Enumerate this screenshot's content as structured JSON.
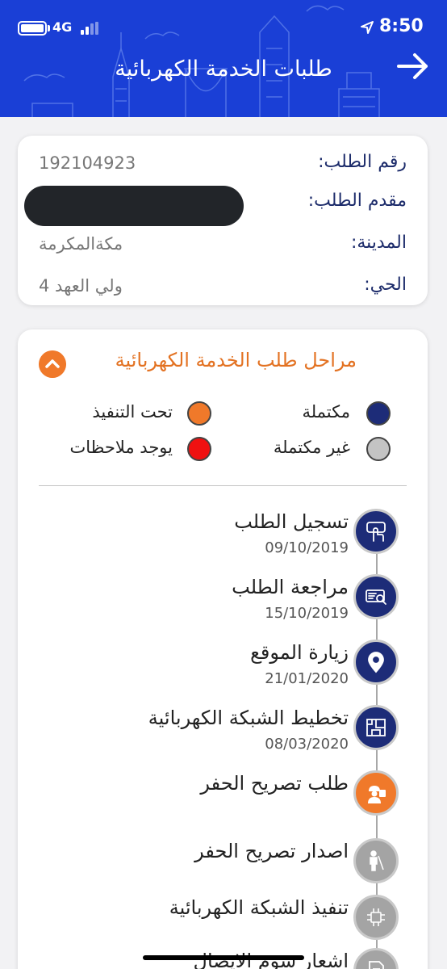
{
  "status_bar": {
    "network": "4G",
    "time": "8:50"
  },
  "header": {
    "title": "طلبات الخدمة الكهربائية"
  },
  "request_info": {
    "request_number_label": "رقم الطلب:",
    "request_number": "192104923",
    "applicant_label": "مقدم الطلب:",
    "city_label": "المدينة:",
    "city": "مكةالمكرمة",
    "district_label": "الحي:",
    "district": "ولي العهد 4"
  },
  "stages": {
    "title": "مراحل طلب الخدمة الكهربائية",
    "legend": [
      {
        "label": "مكتملة",
        "color": "#1d2c78"
      },
      {
        "label": "تحت التنفيذ",
        "color": "#f0792a"
      },
      {
        "label": "غير مكتملة",
        "color": "#c4c4c4"
      },
      {
        "label": "يوجد ملاحظات",
        "color": "#ef1111"
      }
    ],
    "steps": [
      {
        "name": "تسجيل الطلب",
        "date": "09/10/2019",
        "status": "complete",
        "icon": "hand-tap-icon"
      },
      {
        "name": "مراجعة الطلب",
        "date": "15/10/2019",
        "status": "complete",
        "icon": "document-search-icon"
      },
      {
        "name": "زيارة الموقع",
        "date": "21/01/2020",
        "status": "complete",
        "icon": "location-pin-icon"
      },
      {
        "name": "تخطيط الشبكة الكهربائية",
        "date": "08/03/2020",
        "status": "complete",
        "icon": "blueprint-icon"
      },
      {
        "name": "طلب تصريح الحفر",
        "date": "",
        "status": "in-progress",
        "icon": "worker-icon"
      },
      {
        "name": "اصدار تصريح الحفر",
        "date": "",
        "status": "incomplete",
        "icon": "digging-icon"
      },
      {
        "name": "تنفيذ الشبكة الكهربائية",
        "date": "",
        "status": "incomplete",
        "icon": "circuit-icon"
      },
      {
        "name": "اشعار سوم الايصال",
        "date": "",
        "status": "incomplete",
        "icon": "notice-icon"
      }
    ]
  }
}
